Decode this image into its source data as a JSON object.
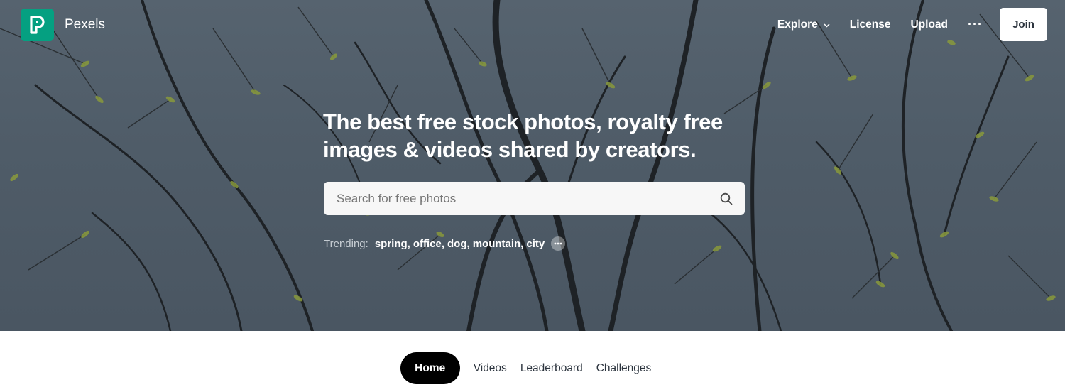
{
  "brand": {
    "name": "Pexels",
    "logo_letter": "P",
    "color": "#05a081"
  },
  "nav": {
    "explore": "Explore",
    "license": "License",
    "upload": "Upload",
    "more": "···",
    "join": "Join"
  },
  "hero": {
    "headline_line1": "The best free stock photos, royalty free",
    "headline_line2": "images & videos shared by creators."
  },
  "search": {
    "placeholder": "Search for free photos",
    "value": ""
  },
  "trending": {
    "label": "Trending:",
    "items": [
      "spring",
      "office",
      "dog",
      "mountain",
      "city"
    ]
  },
  "tabs": [
    {
      "label": "Home",
      "active": true
    },
    {
      "label": "Videos",
      "active": false
    },
    {
      "label": "Leaderboard",
      "active": false
    },
    {
      "label": "Challenges",
      "active": false
    }
  ],
  "icons": {
    "logo": "pexels-logo-icon",
    "explore_chevron": "chevron-down-icon",
    "search": "search-icon",
    "trending_more": "more-dots-icon"
  }
}
